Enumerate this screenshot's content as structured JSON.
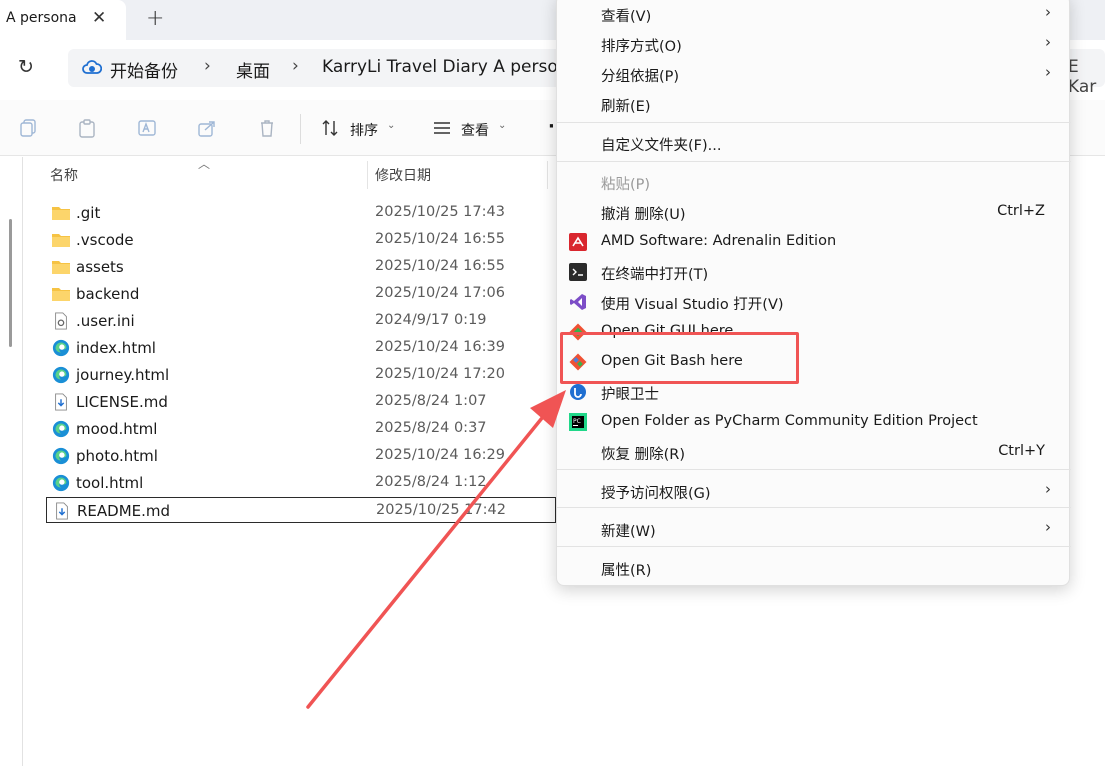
{
  "tab": {
    "title": "A persona",
    "close_glyph": "✕",
    "add_glyph": "+"
  },
  "address": {
    "refresh_glyph": "↻",
    "crumbs": [
      "开始备份",
      "桌面",
      "KarryLi Travel Diary A personal"
    ],
    "separator": "›",
    "tail": "E Kar"
  },
  "toolbar": {
    "icons": [
      "copy-icon",
      "paste-icon",
      "rename-icon",
      "share-icon",
      "delete-icon"
    ],
    "sort_label": "排序",
    "view_label": "查看",
    "more_label": "·"
  },
  "columns": {
    "name": "名称",
    "modified": "修改日期"
  },
  "files": [
    {
      "name": ".git",
      "date": "2025/10/25 17:43",
      "kind": "folder"
    },
    {
      "name": ".vscode",
      "date": "2025/10/24 16:55",
      "kind": "folder"
    },
    {
      "name": "assets",
      "date": "2025/10/24 16:55",
      "kind": "folder"
    },
    {
      "name": "backend",
      "date": "2025/10/24 17:06",
      "kind": "folder"
    },
    {
      "name": ".user.ini",
      "date": "2024/9/17 0:19",
      "kind": "settings"
    },
    {
      "name": "index.html",
      "date": "2025/10/24 16:39",
      "kind": "edge"
    },
    {
      "name": "journey.html",
      "date": "2025/10/24 17:20",
      "kind": "edge"
    },
    {
      "name": "LICENSE.md",
      "date": "2025/8/24 1:07",
      "kind": "markdown"
    },
    {
      "name": "mood.html",
      "date": "2025/8/24 0:37",
      "kind": "edge"
    },
    {
      "name": "photo.html",
      "date": "2025/10/24 16:29",
      "kind": "edge"
    },
    {
      "name": "tool.html",
      "date": "2025/8/24 1:12",
      "kind": "edge"
    },
    {
      "name": "README.md",
      "date": "2025/10/25 17:42",
      "kind": "markdown",
      "selected": true
    }
  ],
  "menu": {
    "arrow_glyph": "›",
    "items": [
      {
        "label": "查看(V)",
        "submenu": true
      },
      {
        "label": "排序方式(O)",
        "submenu": true
      },
      {
        "label": "分组依据(P)",
        "submenu": true
      },
      {
        "label": "刷新(E)"
      },
      {
        "label": "自定义文件夹(F)..."
      },
      {
        "label": "粘贴(P)",
        "disabled": true
      },
      {
        "label": "撤消 删除(U)",
        "shortcut": "Ctrl+Z"
      },
      {
        "label": "AMD Software: Adrenalin Edition",
        "icon": "amd-icon"
      },
      {
        "label": "在终端中打开(T)",
        "icon": "terminal-icon"
      },
      {
        "label": "使用 Visual Studio 打开(V)",
        "icon": "visual-studio-icon"
      },
      {
        "label": "Open Git GUI here",
        "icon": "git-gui-icon"
      },
      {
        "label": "Open Git Bash here",
        "icon": "git-bash-icon"
      },
      {
        "label": "护眼卫士",
        "icon": "eye-guard-icon"
      },
      {
        "label": "Open Folder as PyCharm Community Edition Project",
        "icon": "pycharm-icon"
      },
      {
        "label": "恢复 删除(R)",
        "shortcut": "Ctrl+Y"
      },
      {
        "label": "授予访问权限(G)",
        "submenu": true
      },
      {
        "label": "新建(W)",
        "submenu": true
      },
      {
        "label": "属性(R)"
      }
    ]
  },
  "colors": {
    "highlight": "#f05454",
    "folder": "#f6c344",
    "edge": "#1a8fd6"
  }
}
